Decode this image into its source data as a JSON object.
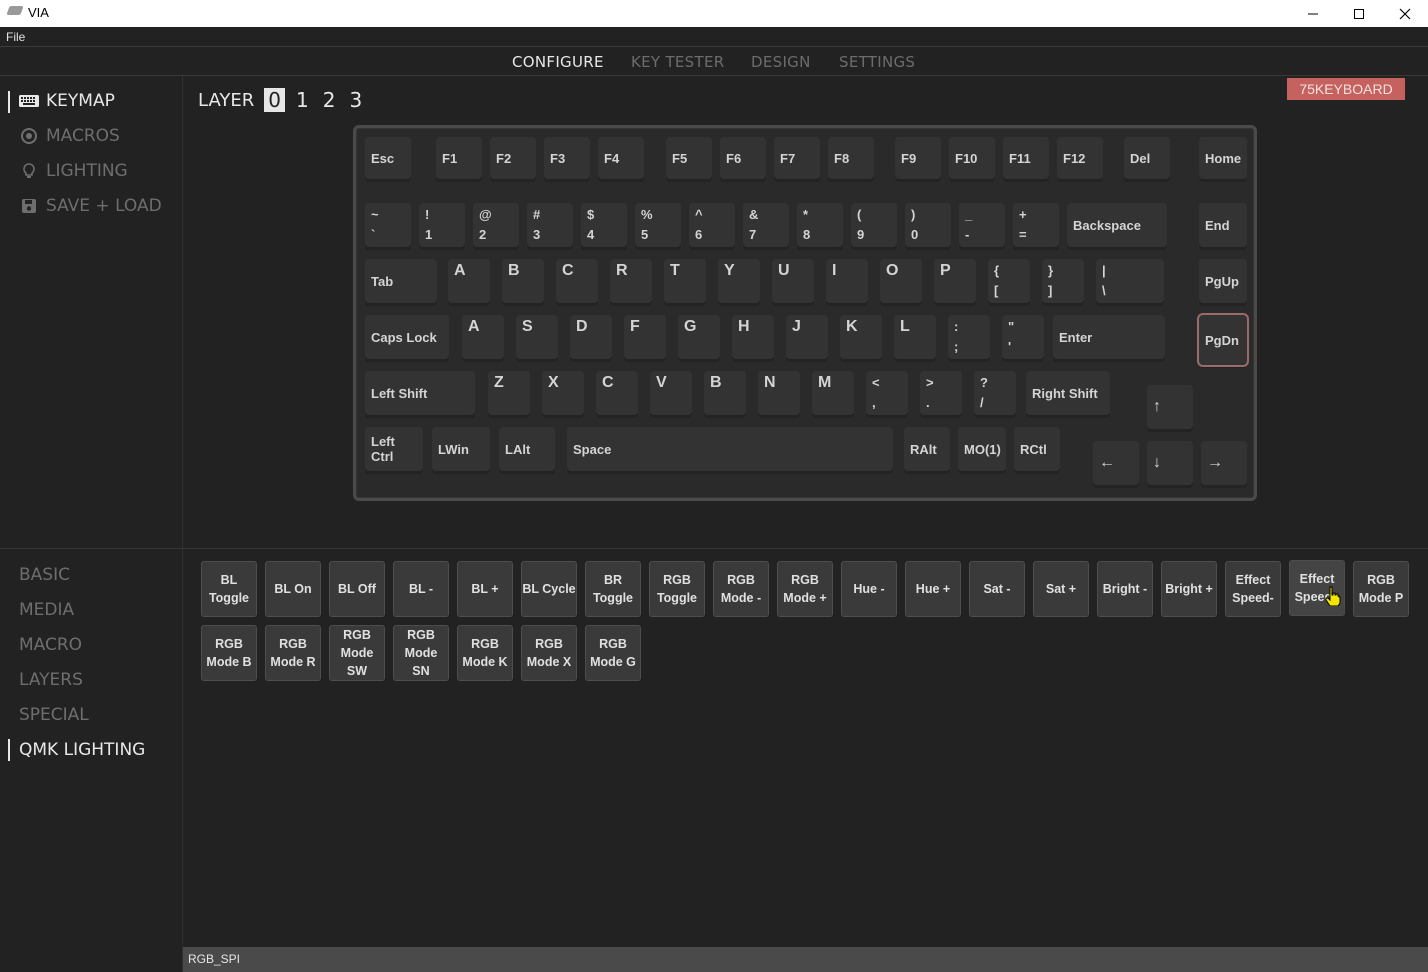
{
  "window": {
    "title": "VIA"
  },
  "menu": {
    "file": "File"
  },
  "tabs": [
    "CONFIGURE",
    "KEY TESTER",
    "DESIGN",
    "SETTINGS"
  ],
  "sidebar": {
    "items": [
      "KEYMAP",
      "MACROS",
      "LIGHTING",
      "SAVE + LOAD"
    ]
  },
  "layer": {
    "label": "LAYER",
    "numbers": [
      "0",
      "1",
      "2",
      "3"
    ]
  },
  "keyboard_name": "75KEYBOARD",
  "keys": {
    "esc": "Esc",
    "f1": "F1",
    "f2": "F2",
    "f3": "F3",
    "f4": "F4",
    "f5": "F5",
    "f6": "F6",
    "f7": "F7",
    "f8": "F8",
    "f9": "F9",
    "f10": "F10",
    "f11": "F11",
    "f12": "F12",
    "del": "Del",
    "home": "Home",
    "grave_t": "~",
    "grave_b": "`",
    "n1_t": "!",
    "n1_b": "1",
    "n2_t": "@",
    "n2_b": "2",
    "n3_t": "#",
    "n3_b": "3",
    "n4_t": "$",
    "n4_b": "4",
    "n5_t": "%",
    "n5_b": "5",
    "n6_t": "^",
    "n6_b": "6",
    "n7_t": "&",
    "n7_b": "7",
    "n8_t": "*",
    "n8_b": "8",
    "n9_t": "(",
    "n9_b": "9",
    "n0_t": ")",
    "n0_b": "0",
    "minus_t": "_",
    "minus_b": "-",
    "equal_t": "+",
    "equal_b": "=",
    "backspace": "Backspace",
    "end": "End",
    "tab": "Tab",
    "q": "A",
    "w": "B",
    "e": "C",
    "r": "R",
    "t": "T",
    "y": "Y",
    "u": "U",
    "i": "I",
    "o": "O",
    "p": "P",
    "lbr_t": "{",
    "lbr_b": "[",
    "rbr_t": "}",
    "rbr_b": "]",
    "bsl_t": "|",
    "bsl_b": "\\",
    "pgup": "PgUp",
    "caps": "Caps Lock",
    "a": "A",
    "s": "S",
    "d": "D",
    "f": "F",
    "g": "G",
    "h": "H",
    "j": "J",
    "k": "K",
    "l": "L",
    "scl_t": ":",
    "scl_b": ";",
    "quo_t": "\"",
    "quo_b": "'",
    "enter": "Enter",
    "pgdn": "PgDn",
    "lshift": "Left Shift",
    "z": "Z",
    "x": "X",
    "c": "C",
    "v": "V",
    "b": "B",
    "n": "N",
    "m": "M",
    "com_t": "<",
    "com_b": ",",
    "dot_t": ">",
    "dot_b": ".",
    "sl_t": "?",
    "sl_b": "/",
    "rshift": "Right Shift",
    "up": "↑",
    "lctrl": "Left Ctrl",
    "lwin": "LWin",
    "lalt": "LAlt",
    "space": "Space",
    "ralt": "RAlt",
    "mo1": "MO(1)",
    "rctl": "RCtl",
    "left": "←",
    "down": "↓",
    "right": "→"
  },
  "categories": [
    "BASIC",
    "MEDIA",
    "MACRO",
    "LAYERS",
    "SPECIAL",
    "QMK LIGHTING"
  ],
  "keycodes": [
    "BL\nToggle",
    "BL On",
    "BL Off",
    "BL -",
    "BL +",
    "BL Cycle",
    "BR\nToggle",
    "RGB\nToggle",
    "RGB\nMode -",
    "RGB\nMode +",
    "Hue -",
    "Hue +",
    "Sat -",
    "Sat +",
    "Bright -",
    "Bright +",
    "Effect\nSpeed-",
    "Effect\nSpeed+",
    "RGB\nMode P",
    "RGB\nMode B",
    "RGB\nMode R",
    "RGB\nMode\nSW",
    "RGB\nMode\nSN",
    "RGB\nMode K",
    "RGB\nMode X",
    "RGB\nMode G"
  ],
  "status": "RGB_SPI"
}
